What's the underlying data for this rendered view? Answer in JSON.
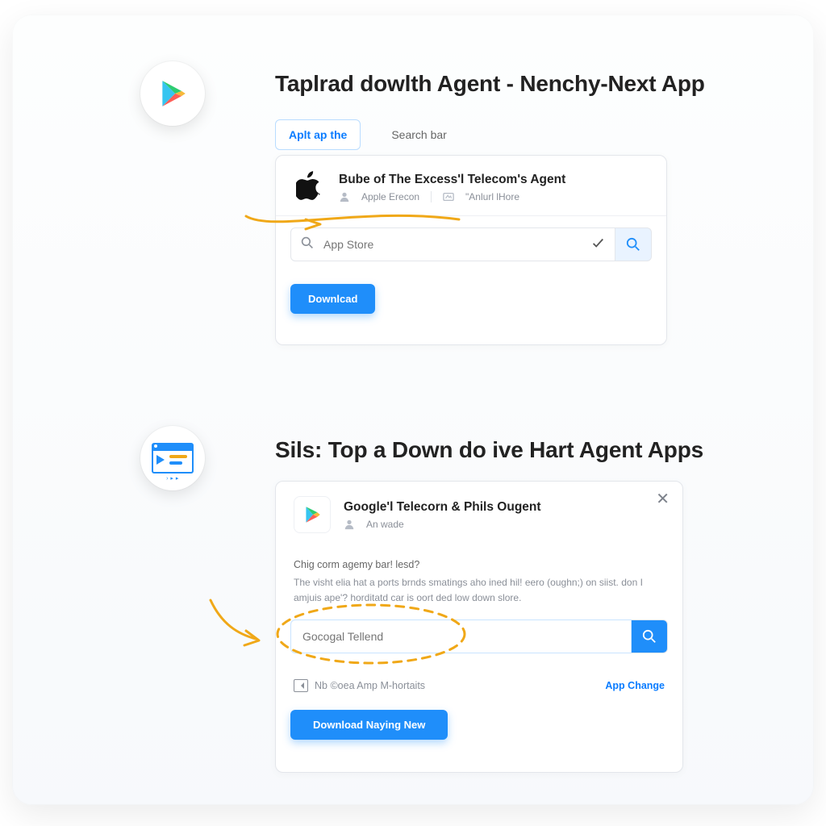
{
  "step1": {
    "heading": "Taplrad dowlth Agent - Nenchy-Next App",
    "tabs": {
      "active_label": "Aplt ap the",
      "secondary_label": "Search bar"
    },
    "app": {
      "title": "Bube of The Excess'l Telecom's Agent",
      "meta1": "Apple Erecon",
      "meta2": "\"Anlurl lHore"
    },
    "search": {
      "placeholder": "App Store",
      "value": ""
    },
    "download_label": "Downlcad"
  },
  "step2": {
    "heading": "Sils: Top a Down do ive Hart Agent Apps",
    "app": {
      "title": "Google'l Telecorn & Phils Ougent",
      "publisher": "An wade"
    },
    "question": "Chig corm agemy bar! lesd?",
    "desc": "The visht elia hat a ports brnds smatings aho ined hil! eero (oughn;) on siist. don I amjuis ape'? horditatd car is oort ded low down  slore.",
    "search": {
      "placeholder": "Gocogal Tellend",
      "value": ""
    },
    "footer_note": "Nb ©oea Amp M-hortaits",
    "footer_link": "App Change",
    "download_label": "Download Naying New"
  },
  "icons": {
    "play_triangle": "play-store-icon",
    "window_player": "media-window-icon",
    "apple": "apple-icon",
    "search": "search-icon",
    "check": "check-icon",
    "close": "close-icon",
    "person": "person-icon",
    "card": "card-icon"
  },
  "colors": {
    "accent_blue": "#1f8efa",
    "annotation_orange": "#f0a818"
  }
}
